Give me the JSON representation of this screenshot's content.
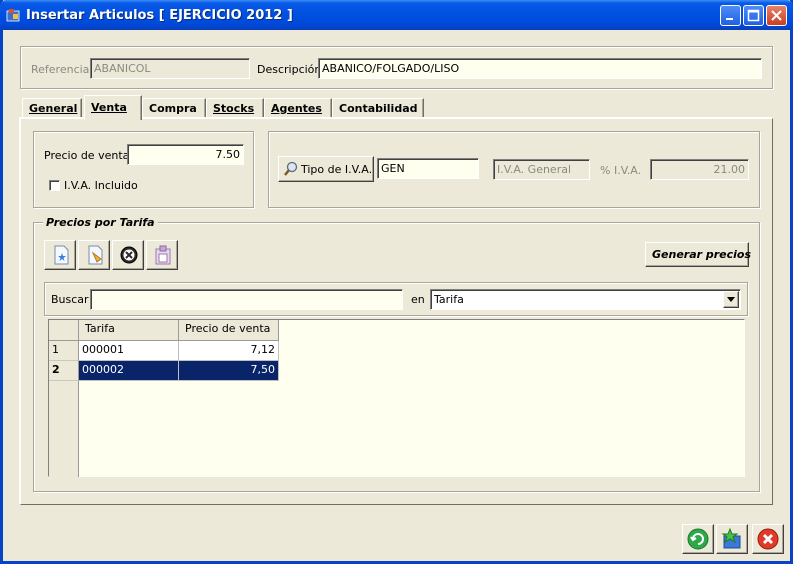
{
  "window": {
    "title": "Insertar Articulos [ EJERCICIO 2012 ]"
  },
  "header": {
    "referencia_label": "Referencia",
    "referencia_value": "ABANICOL",
    "descripcion_label": "Descripción",
    "descripcion_value": "ABANICO/FOLGADO/LISO"
  },
  "tabs": [
    {
      "label": "General",
      "active": false
    },
    {
      "label": "Venta",
      "active": true
    },
    {
      "label": "Compra",
      "active": false
    },
    {
      "label": "Stocks",
      "active": false
    },
    {
      "label": "Agentes",
      "active": false
    },
    {
      "label": "Contabilidad",
      "active": false
    }
  ],
  "venta": {
    "precio_label": "Precio de venta",
    "precio_value": "7.50",
    "iva_incluido_label": "I.V.A. Incluido",
    "iva_incluido_checked": false,
    "tipo_iva_button": "Tipo de I.V.A.",
    "tipo_iva_value": "GEN",
    "iva_general_value": "I.V.A. General",
    "pct_iva_label": "% I.V.A.",
    "pct_iva_value": "21.00"
  },
  "tarifas": {
    "group_title": "Precios por Tarifa",
    "toolbar_icons": [
      "new-record-icon",
      "edit-record-icon",
      "delete-record-icon",
      "paste-record-icon"
    ],
    "generar_button": "Generar precios",
    "buscar_label": "Buscar",
    "buscar_value": "",
    "en_label": "en",
    "en_selected": "Tarifa",
    "columns": [
      "Tarifa",
      "Precio de venta"
    ],
    "rows": [
      {
        "index": "1",
        "tarifa": "000001",
        "precio": "7,12",
        "selected": false
      },
      {
        "index": "2",
        "tarifa": "000002",
        "precio": "7,50",
        "selected": true
      }
    ]
  },
  "footer_icons": [
    "refresh-icon",
    "save-icon",
    "close-icon"
  ],
  "colors": {
    "titlebar": "#0050e0",
    "selection": "#0a246a",
    "field_bg": "#fffff0",
    "window_bg": "#ece9d8"
  }
}
